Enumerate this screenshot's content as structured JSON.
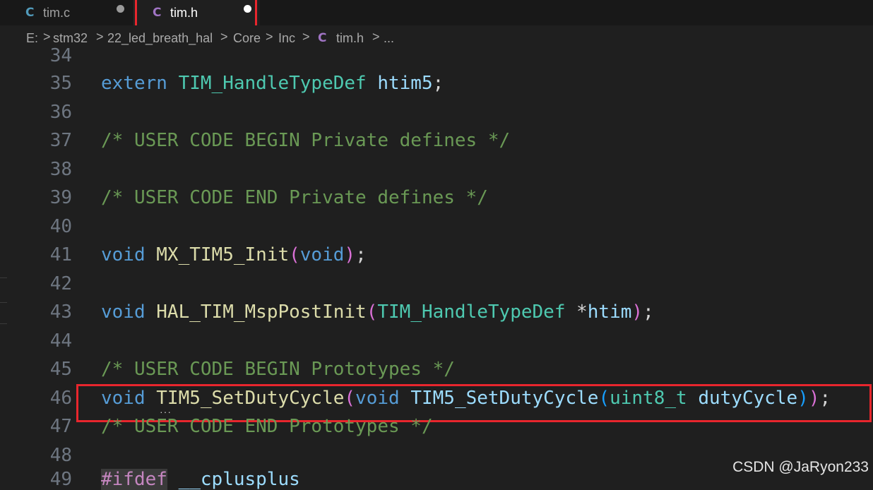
{
  "tabs": [
    {
      "icon": "C",
      "label": "tim.c",
      "modified": true
    },
    {
      "icon": "C",
      "label": "tim.h",
      "modified": true
    }
  ],
  "breadcrumb": {
    "items": [
      "E:",
      "stm32",
      "22_led_breath_hal",
      "Core",
      "Inc",
      "tim.h",
      "..."
    ],
    "file_icon": "C",
    "separator": ">"
  },
  "editor": {
    "lines": [
      {
        "no": "34"
      },
      {
        "no": "35"
      },
      {
        "no": "36"
      },
      {
        "no": "37"
      },
      {
        "no": "38"
      },
      {
        "no": "39"
      },
      {
        "no": "40"
      },
      {
        "no": "41"
      },
      {
        "no": "42"
      },
      {
        "no": "43"
      },
      {
        "no": "44"
      },
      {
        "no": "45"
      },
      {
        "no": "46"
      },
      {
        "no": "47"
      },
      {
        "no": "48"
      },
      {
        "no": "49"
      }
    ],
    "code": {
      "l35": {
        "t1": "extern",
        "t2": "TIM_HandleTypeDef",
        "t3": "htim5",
        "t4": ";"
      },
      "l37": "/* USER CODE BEGIN Private defines */",
      "l39": "/* USER CODE END Private defines */",
      "l41": {
        "t1": "void",
        "t2": "MX_TIM5_Init",
        "t3": "(",
        "t4": "void",
        "t5": ")",
        "t6": ";"
      },
      "l43": {
        "t1": "void",
        "t2": "HAL_TIM_MspPostInit",
        "t3": "(",
        "t4": "TIM_HandleTypeDef",
        "t5": " *",
        "t6": "htim",
        "t7": ")",
        "t8": ";"
      },
      "l45": "/* USER CODE BEGIN Prototypes */",
      "l46": {
        "t1": "void",
        "t2": "TIM5_SetDutyCycle",
        "t3": "(",
        "t4": "void",
        "t5": "TIM5_SetDutyCycle",
        "t6": "(",
        "t7": "uint8_t",
        "t8": "dutyCycle",
        "t9": ")",
        "t10": ")",
        "t11": ";"
      },
      "l47": "/* USER CODE END Prototypes */",
      "l49": {
        "t1": "#ifdef",
        "t2": "__cplusplus"
      }
    }
  },
  "watermark": "CSDN @JaRyon233",
  "colors": {
    "highlight_box": "#e8262d",
    "c_icon_tab1": "#519aba",
    "c_icon_tab2": "#a074c4"
  }
}
